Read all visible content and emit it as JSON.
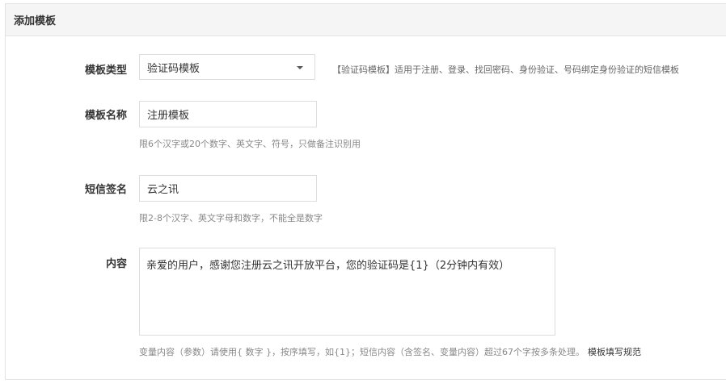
{
  "panel": {
    "title": "添加模板"
  },
  "form": {
    "template_type": {
      "label": "模板类型",
      "selected": "验证码模板",
      "hint": "【验证码模板】适用于注册、登录、找回密码、身份验证、号码绑定身份验证的短信模板"
    },
    "template_name": {
      "label": "模板名称",
      "value": "注册模板",
      "hint": "限6个汉字或20个数字、英文字、符号，只做备注识别用"
    },
    "sms_signature": {
      "label": "短信签名",
      "value": "云之讯",
      "hint": "限2-8个汉字、英文字母和数字，不能全是数字"
    },
    "content": {
      "label": "内容",
      "value": "亲爱的用户，感谢您注册云之讯开放平台，您的验证码是{1}（2分钟内有效）",
      "hint": "变量内容（参数）请使用{ 数字 }，按序填写，如{1}；短信内容（含签名、变量内容）超过67个字按多条处理。",
      "hint_link": "模板填写规范"
    }
  }
}
